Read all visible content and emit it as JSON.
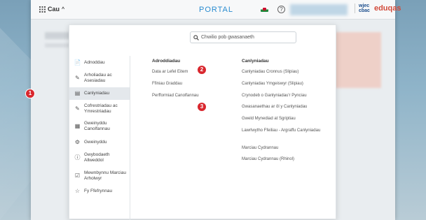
{
  "topbar": {
    "menu_label": "Cau",
    "portal": "PORTAL",
    "help": "?",
    "wjec": "wjec\ncbac",
    "eduqas": "eduqas"
  },
  "search": {
    "placeholder": "Chwilio pob gwasanaeth"
  },
  "sidebar": {
    "items": [
      {
        "label": "Adnoddau",
        "icon": "document-icon"
      },
      {
        "label": "Arholiadau ac Asesiadau",
        "icon": "pen-icon"
      },
      {
        "label": "Canlyniadau",
        "icon": "results-icon"
      },
      {
        "label": "Cofrestriadau ac Ymrestriadau",
        "icon": "registration-icon"
      },
      {
        "label": "Gweinyddu Canolfannau",
        "icon": "building-icon"
      },
      {
        "label": "Gweinyddu",
        "icon": "gear-icon"
      },
      {
        "label": "Gwybodaeth Allweddol",
        "icon": "info-icon"
      },
      {
        "label": "Mewnbynnu Marciau Arholwyr",
        "icon": "marks-icon"
      },
      {
        "label": "Fy Ffefrynnau",
        "icon": "star-icon"
      }
    ]
  },
  "columns": {
    "reports": {
      "heading": "Adroddiadau",
      "links": [
        "Data ar Lefel Eitem",
        "Ffiniau Graddau",
        "Perfformiad Canolfannau"
      ]
    },
    "results": {
      "heading": "Canlyniadau",
      "links": [
        "Canlyniadau Cronnus (Slipiau)",
        "Canlyniadau Ymgeiswyr (Slipiau)",
        "Crynodeb o Ganlyniadau'r Pynciau",
        "Gwasanaethau ar ôl y Canlyniadau",
        "Gweld Mynediad at Sgriptiau",
        "Lawrlwytho Ffeiliau - Argraffu Canlyniadau",
        "Marciau Cydrannau",
        "Marciau Cydrannau (Rhinol)"
      ]
    }
  },
  "badges": [
    "1",
    "2",
    "3"
  ],
  "colors": {
    "portal": "#2a8cd0",
    "badge": "#d9272e",
    "eduqas": "#d24a3a"
  }
}
